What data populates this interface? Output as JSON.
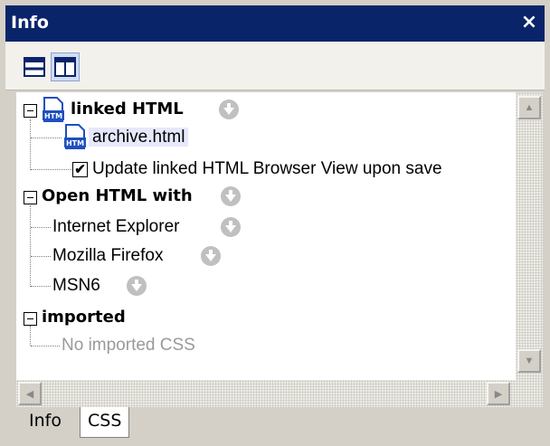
{
  "window": {
    "title": "Info",
    "close_glyph": "×"
  },
  "toolbar": {
    "buttons": [
      {
        "icon": "horizontal-layout-icon",
        "active": false
      },
      {
        "icon": "vertical-layout-icon",
        "active": true
      }
    ]
  },
  "tree": {
    "linked_html": {
      "label": "linked HTML",
      "file": "archive.html",
      "checkbox_label": "Update linked HTML Browser View upon save",
      "checkbox_checked": true
    },
    "open_with": {
      "label": "Open HTML with",
      "items": [
        "Internet Explorer",
        "Mozilla Firefox",
        "MSN6"
      ]
    },
    "imported": {
      "label": "imported",
      "empty_text": "No imported CSS"
    }
  },
  "tabs": [
    {
      "label": "Info",
      "active": false
    },
    {
      "label": "CSS",
      "active": true
    }
  ],
  "colors": {
    "title_bg": "#0a246a",
    "selected_bg": "#e6e8fb",
    "accent_icon": "#1f4fbf"
  }
}
